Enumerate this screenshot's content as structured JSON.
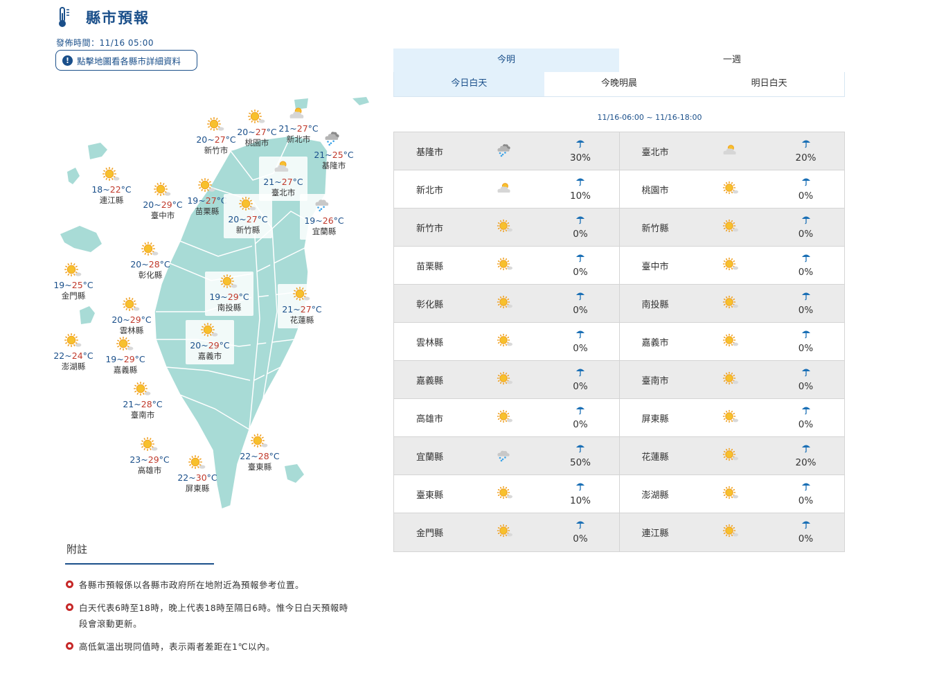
{
  "header": {
    "title": "縣市預報",
    "issue_time": "發佈時間：11/16 05:00",
    "map_hint": "點擊地圖看各縣市詳細資料"
  },
  "tabs": {
    "main": [
      "今明",
      "一週"
    ],
    "sub": [
      "今日白天",
      "今晚明晨",
      "明日白天"
    ],
    "active_main": 0,
    "active_sub": 0
  },
  "period": "11/16-06:00 ~ 11/16-18:00",
  "map_cities": [
    {
      "name": "新竹市",
      "min": "20",
      "max": "27",
      "wx": "sunny"
    },
    {
      "name": "桃園市",
      "min": "20",
      "max": "27",
      "wx": "sunny"
    },
    {
      "name": "新北市",
      "min": "21",
      "max": "27",
      "wx": "cloudy-sun"
    },
    {
      "name": "基隆市",
      "min": "21",
      "max": "25",
      "wx": "cloudy-rain"
    },
    {
      "name": "臺北市",
      "min": "21",
      "max": "27",
      "wx": "cloudy-sun"
    },
    {
      "name": "連江縣",
      "min": "18",
      "max": "22",
      "wx": "sunny"
    },
    {
      "name": "臺中市",
      "min": "20",
      "max": "29",
      "wx": "sunny"
    },
    {
      "name": "苗栗縣",
      "min": "19",
      "max": "27",
      "wx": "sunny"
    },
    {
      "name": "新竹縣",
      "min": "20",
      "max": "27",
      "wx": "sunny"
    },
    {
      "name": "宜蘭縣",
      "min": "19",
      "max": "26",
      "wx": "rain"
    },
    {
      "name": "彰化縣",
      "min": "20",
      "max": "28",
      "wx": "sunny"
    },
    {
      "name": "金門縣",
      "min": "19",
      "max": "25",
      "wx": "sunny"
    },
    {
      "name": "南投縣",
      "min": "19",
      "max": "29",
      "wx": "sunny"
    },
    {
      "name": "花蓮縣",
      "min": "21",
      "max": "27",
      "wx": "sunny"
    },
    {
      "name": "雲林縣",
      "min": "20",
      "max": "29",
      "wx": "sunny"
    },
    {
      "name": "嘉義市",
      "min": "20",
      "max": "29",
      "wx": "sunny"
    },
    {
      "name": "澎湖縣",
      "min": "22",
      "max": "24",
      "wx": "sunny"
    },
    {
      "name": "嘉義縣",
      "min": "19",
      "max": "29",
      "wx": "sunny"
    },
    {
      "name": "臺南市",
      "min": "21",
      "max": "28",
      "wx": "sunny"
    },
    {
      "name": "高雄市",
      "min": "23",
      "max": "29",
      "wx": "sunny"
    },
    {
      "name": "屏東縣",
      "min": "22",
      "max": "30",
      "wx": "sunny"
    },
    {
      "name": "臺東縣",
      "min": "22",
      "max": "28",
      "wx": "sunny"
    }
  ],
  "forecast_rows": [
    [
      {
        "name": "基隆市",
        "wx": "cloudy-rain",
        "pop": "30%"
      },
      {
        "name": "臺北市",
        "wx": "cloudy-sun",
        "pop": "20%"
      }
    ],
    [
      {
        "name": "新北市",
        "wx": "cloudy-sun",
        "pop": "10%"
      },
      {
        "name": "桃園市",
        "wx": "sunny",
        "pop": "0%"
      }
    ],
    [
      {
        "name": "新竹市",
        "wx": "sunny",
        "pop": "0%"
      },
      {
        "name": "新竹縣",
        "wx": "sunny",
        "pop": "0%"
      }
    ],
    [
      {
        "name": "苗栗縣",
        "wx": "sunny",
        "pop": "0%"
      },
      {
        "name": "臺中市",
        "wx": "sunny",
        "pop": "0%"
      }
    ],
    [
      {
        "name": "彰化縣",
        "wx": "sunny",
        "pop": "0%"
      },
      {
        "name": "南投縣",
        "wx": "sunny",
        "pop": "0%"
      }
    ],
    [
      {
        "name": "雲林縣",
        "wx": "sunny",
        "pop": "0%"
      },
      {
        "name": "嘉義市",
        "wx": "sunny",
        "pop": "0%"
      }
    ],
    [
      {
        "name": "嘉義縣",
        "wx": "sunny",
        "pop": "0%"
      },
      {
        "name": "臺南市",
        "wx": "sunny",
        "pop": "0%"
      }
    ],
    [
      {
        "name": "高雄市",
        "wx": "sunny",
        "pop": "0%"
      },
      {
        "name": "屏東縣",
        "wx": "sunny",
        "pop": "0%"
      }
    ],
    [
      {
        "name": "宜蘭縣",
        "wx": "rain",
        "pop": "50%"
      },
      {
        "name": "花蓮縣",
        "wx": "sunny",
        "pop": "20%"
      }
    ],
    [
      {
        "name": "臺東縣",
        "wx": "sunny",
        "pop": "10%"
      },
      {
        "name": "澎湖縣",
        "wx": "sunny",
        "pop": "0%"
      }
    ],
    [
      {
        "name": "金門縣",
        "wx": "sunny",
        "pop": "0%"
      },
      {
        "name": "連江縣",
        "wx": "sunny",
        "pop": "0%"
      }
    ]
  ],
  "notes": {
    "title": "附註",
    "items": [
      "各縣市預報係以各縣市政府所在地附近為預報參考位置。",
      "白天代表6時至18時，晚上代表18時至隔日6時。惟今日白天預報時段會滾動更新。",
      "高低氣溫出現同值時，表示兩者差距在1℃以內。"
    ]
  },
  "temp_unit": "°C",
  "colors": {
    "brand": "#1a4f8a",
    "tab_active": "#e3f1fb",
    "map_land": "#a8dbd6",
    "temp_max": "#c0392b",
    "note_dot": "#c62828"
  }
}
